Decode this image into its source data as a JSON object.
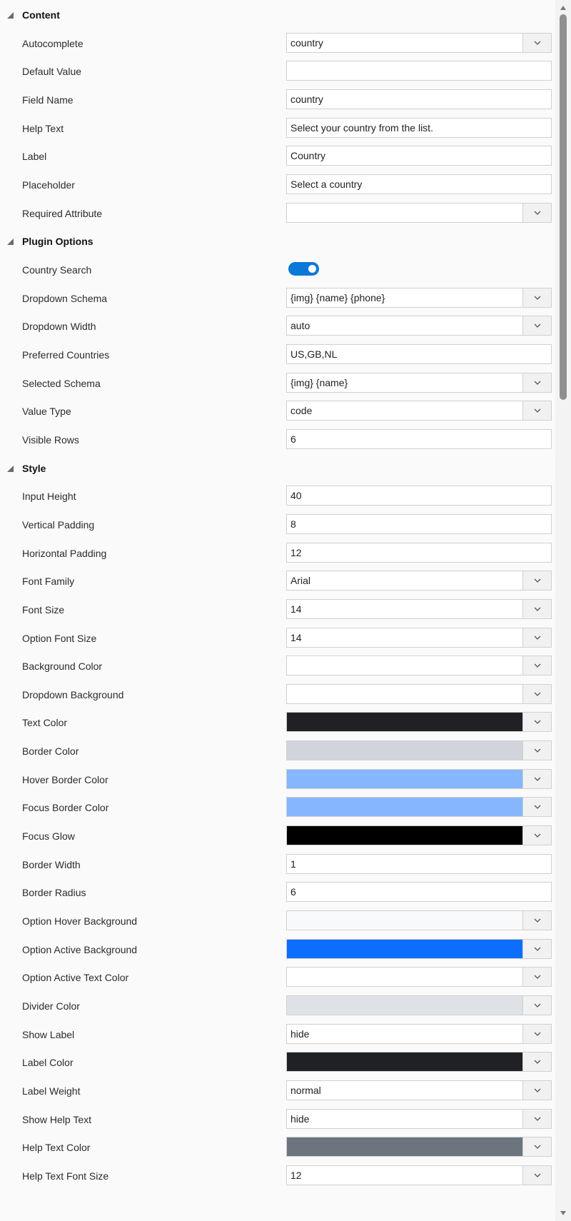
{
  "sections": [
    {
      "title": "Content",
      "rows": [
        {
          "label": "Autocomplete",
          "type": "select",
          "value": "country"
        },
        {
          "label": "Default Value",
          "type": "text",
          "value": ""
        },
        {
          "label": "Field Name",
          "type": "text",
          "value": "country"
        },
        {
          "label": "Help Text",
          "type": "text",
          "value": "Select your country from the list."
        },
        {
          "label": "Label",
          "type": "text",
          "value": "Country"
        },
        {
          "label": "Placeholder",
          "type": "text",
          "value": "Select a country"
        },
        {
          "label": "Required Attribute",
          "type": "select",
          "value": ""
        }
      ]
    },
    {
      "title": "Plugin Options",
      "rows": [
        {
          "label": "Country Search",
          "type": "toggle",
          "on": true
        },
        {
          "label": "Dropdown Schema",
          "type": "select",
          "value": "{img} {name} {phone}"
        },
        {
          "label": "Dropdown Width",
          "type": "select",
          "value": "auto"
        },
        {
          "label": "Preferred Countries",
          "type": "text",
          "value": "US,GB,NL"
        },
        {
          "label": "Selected Schema",
          "type": "select",
          "value": "{img} {name}"
        },
        {
          "label": "Value Type",
          "type": "select",
          "value": "code"
        },
        {
          "label": "Visible Rows",
          "type": "text",
          "value": "6"
        }
      ]
    },
    {
      "title": "Style",
      "rows": [
        {
          "label": "Input Height",
          "type": "text",
          "value": "40"
        },
        {
          "label": "Vertical Padding",
          "type": "text",
          "value": "8"
        },
        {
          "label": "Horizontal Padding",
          "type": "text",
          "value": "12"
        },
        {
          "label": "Font Family",
          "type": "select",
          "value": "Arial"
        },
        {
          "label": "Font Size",
          "type": "select",
          "value": "14"
        },
        {
          "label": "Option Font Size",
          "type": "select",
          "value": "14"
        },
        {
          "label": "Background Color",
          "type": "color",
          "color": "#ffffff"
        },
        {
          "label": "Dropdown Background",
          "type": "color",
          "color": "#ffffff"
        },
        {
          "label": "Text Color",
          "type": "color",
          "color": "#1f2125"
        },
        {
          "label": "Border Color",
          "type": "color",
          "color": "#d1d4da"
        },
        {
          "label": "Hover Border Color",
          "type": "color",
          "color": "#86b7fe"
        },
        {
          "label": "Focus Border Color",
          "type": "color",
          "color": "#86b7fe"
        },
        {
          "label": "Focus Glow",
          "type": "color",
          "color": "#000000"
        },
        {
          "label": "Border Width",
          "type": "text",
          "value": "1"
        },
        {
          "label": "Border Radius",
          "type": "text",
          "value": "6"
        },
        {
          "label": "Option Hover Background",
          "type": "color",
          "color": "#f8f9fa"
        },
        {
          "label": "Option Active Background",
          "type": "color",
          "color": "#0d6efd"
        },
        {
          "label": "Option Active Text Color",
          "type": "color",
          "color": "#ffffff"
        },
        {
          "label": "Divider Color",
          "type": "color",
          "color": "#dee2e6"
        },
        {
          "label": "Show Label",
          "type": "select",
          "value": "hide"
        },
        {
          "label": "Label Color",
          "type": "color",
          "color": "#1f2125"
        },
        {
          "label": "Label Weight",
          "type": "select",
          "value": "normal"
        },
        {
          "label": "Show Help Text",
          "type": "select",
          "value": "hide"
        },
        {
          "label": "Help Text Color",
          "type": "color",
          "color": "#6c757d"
        },
        {
          "label": "Help Text Font Size",
          "type": "select",
          "value": "12"
        }
      ]
    }
  ],
  "colors": {
    "accent": "#0a78d7",
    "control_border": "#d0d0d0",
    "dropdown_button": "#f1f1f1",
    "panel_background": "#fafafa"
  }
}
